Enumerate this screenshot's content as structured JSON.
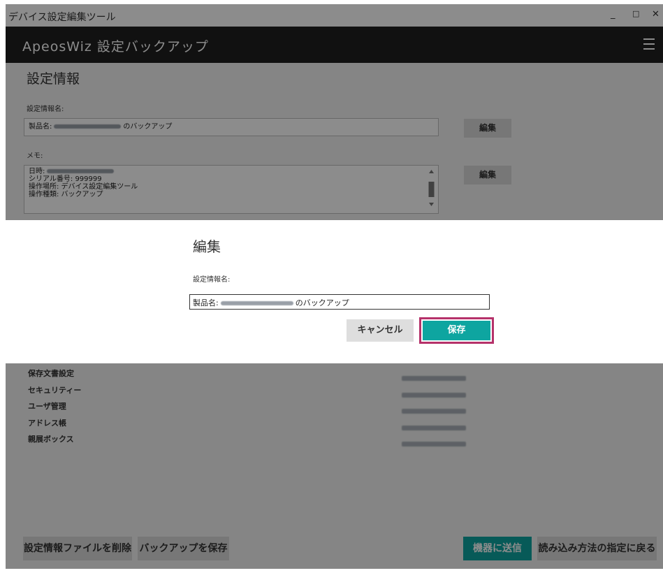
{
  "window": {
    "title": "デバイス設定編集ツール",
    "controls": [
      "_",
      "□",
      "✕"
    ]
  },
  "header": {
    "title": "ApeosWiz 設定バックアップ"
  },
  "section": {
    "title": "設定情報",
    "name_label": "設定情報名:",
    "name_prefix": "製品名:",
    "name_suffix": "のバックアップ",
    "edit_label": "編集",
    "memo_label": "メモ:",
    "memo": {
      "date_label": "日時:",
      "serial": "シリアル番号: 999999",
      "location": "操作場所: デバイス設定編集ツール",
      "type": "操作種類: バックアップ"
    }
  },
  "list": {
    "items": [
      "保存文書設定",
      "セキュリティー",
      "ユーザ管理",
      "アドレス帳",
      "親展ボックス"
    ]
  },
  "footer": {
    "delete_label": "設定情報ファイルを削除",
    "save_backup_label": "バックアップを保存",
    "send_label": "機器に送信",
    "back_label": "読み込み方法の指定に戻る"
  },
  "dialog": {
    "title": "編集",
    "field_label": "設定情報名:",
    "input_prefix": "製品名:",
    "input_suffix": "のバックアップ",
    "cancel_label": "キャンセル",
    "save_label": "保存"
  },
  "colors": {
    "accent": "#0ea5a0",
    "highlight_border": "#b5326a",
    "header_bg": "#1f1f1f"
  }
}
